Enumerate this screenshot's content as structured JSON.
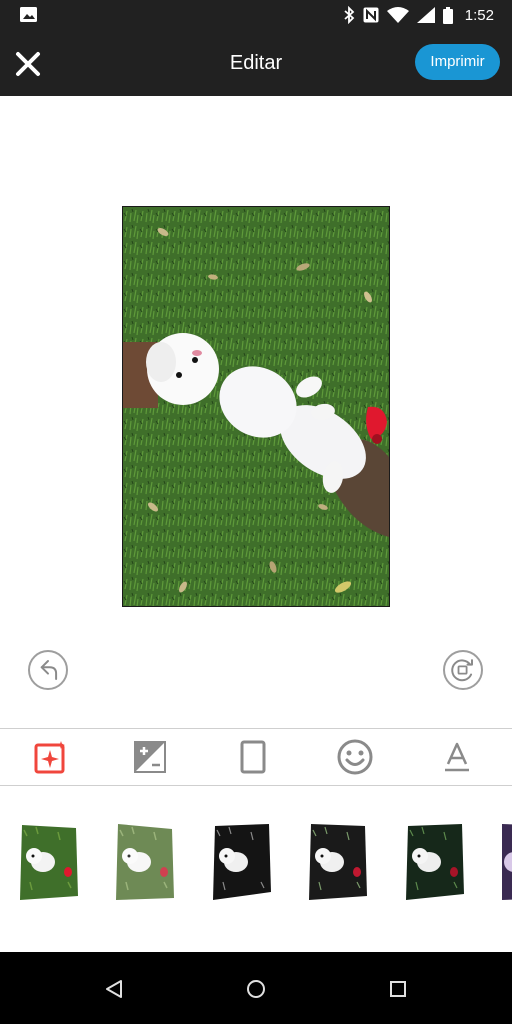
{
  "status_bar": {
    "time": "1:52",
    "icons": [
      "image-notification-icon",
      "bluetooth-icon",
      "nfc-icon",
      "wifi-icon",
      "cellular-icon",
      "battery-icon"
    ]
  },
  "app_bar": {
    "title": "Editar",
    "print_label": "Imprimir",
    "close_icon": "close-icon"
  },
  "editor": {
    "photo_description_icon": "photo-preview",
    "undo_icon": "undo-icon",
    "rotate_icon": "rotate-icon"
  },
  "tools": [
    {
      "name": "magic-enhance",
      "icon": "sparkle-square-icon",
      "active": true
    },
    {
      "name": "exposure",
      "icon": "exposure-icon",
      "active": false
    },
    {
      "name": "frame",
      "icon": "frame-icon",
      "active": false
    },
    {
      "name": "sticker",
      "icon": "smiley-icon",
      "active": false
    },
    {
      "name": "text",
      "icon": "text-icon",
      "active": false
    }
  ],
  "filters": [
    {
      "name": "filter-original",
      "style": "normal"
    },
    {
      "name": "filter-faded",
      "style": "faded"
    },
    {
      "name": "filter-dark-1",
      "style": "dark"
    },
    {
      "name": "filter-dark-2",
      "style": "dark"
    },
    {
      "name": "filter-dark-3",
      "style": "dark"
    },
    {
      "name": "filter-purple",
      "style": "purple"
    }
  ],
  "colors": {
    "bar": "#212121",
    "accent": "#1a96d4",
    "active_tool": "#f0463c",
    "icon_gray": "#8a8a8a"
  },
  "nav_bar": {
    "back_icon": "back-triangle-icon",
    "home_icon": "home-circle-icon",
    "recents_icon": "recents-square-icon"
  }
}
